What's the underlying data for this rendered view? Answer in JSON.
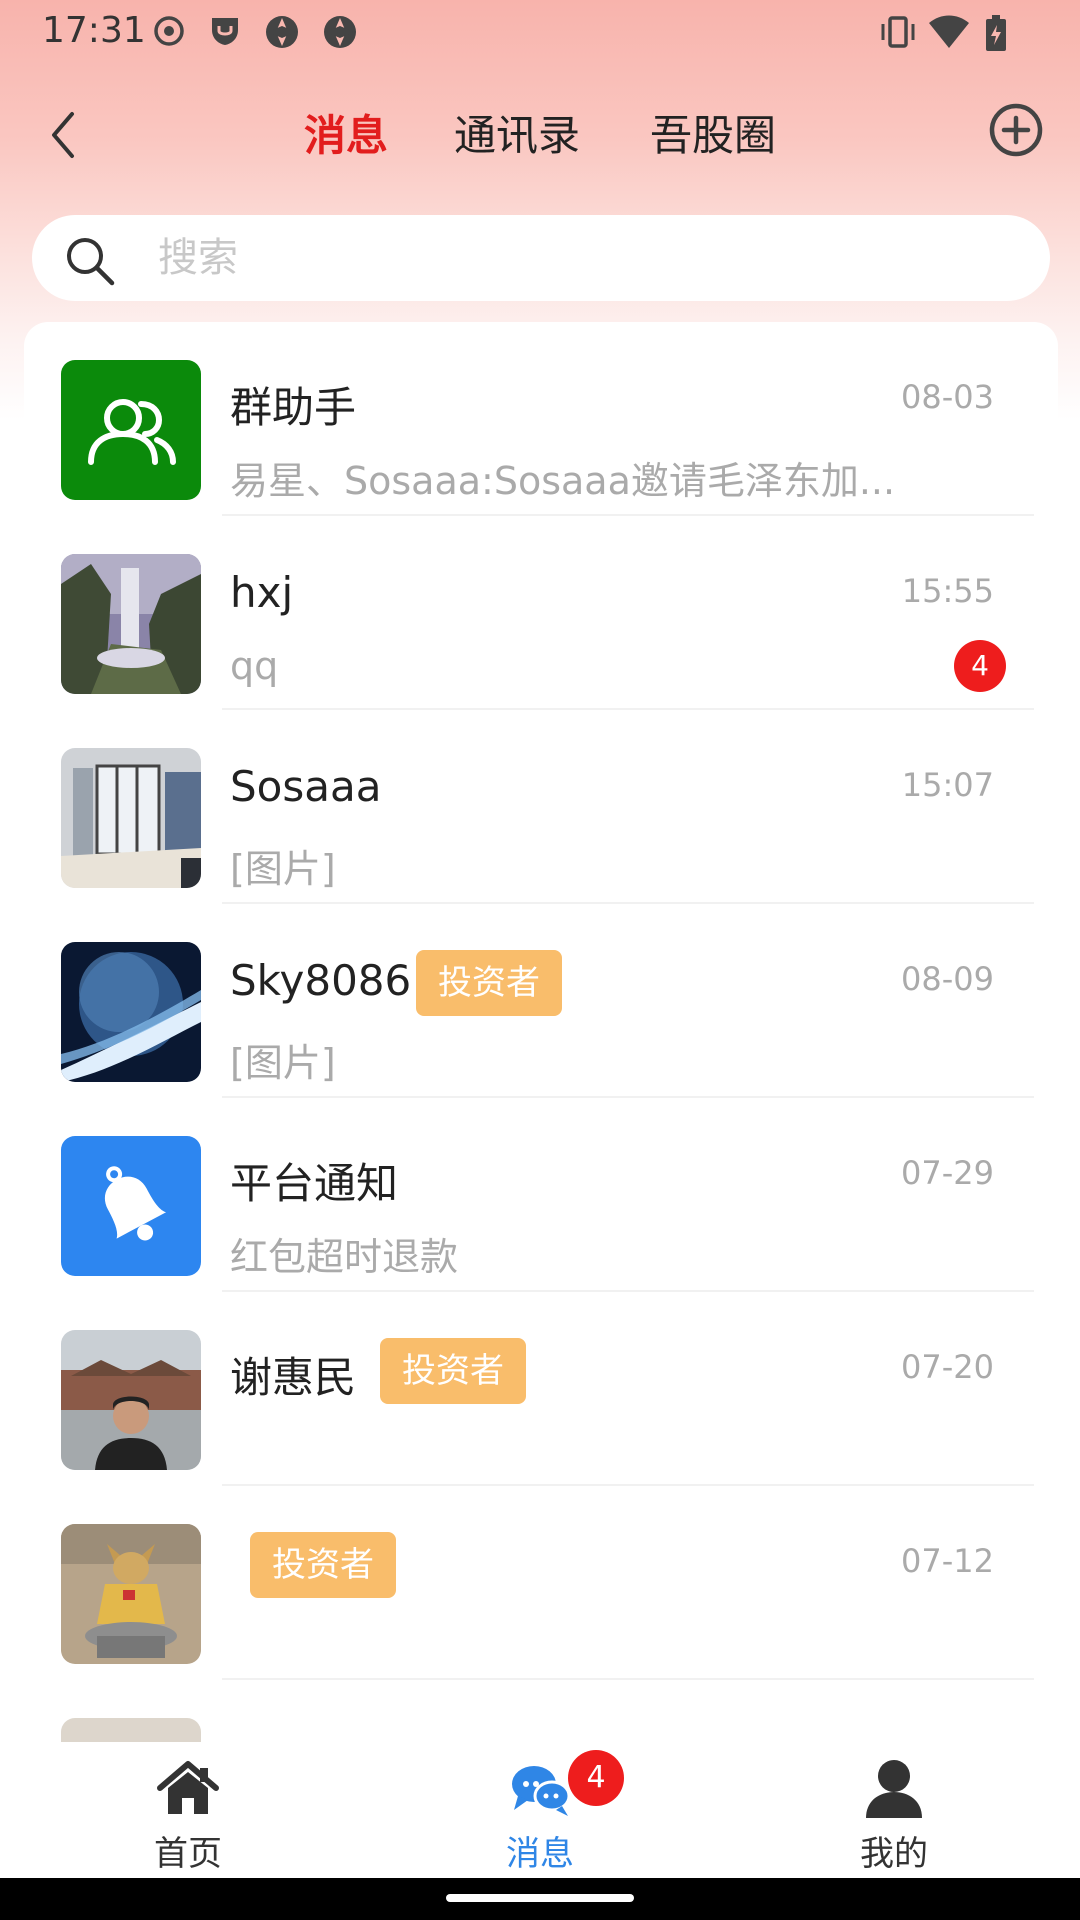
{
  "status_bar": {
    "time": "17:31",
    "left_icons": [
      "record-icon",
      "shield-icon",
      "app-icon",
      "app-icon"
    ],
    "right_icons": [
      "vibrate-icon",
      "wifi-icon",
      "battery-icon"
    ]
  },
  "header": {
    "tabs": [
      {
        "label": "消息",
        "active": true
      },
      {
        "label": "通讯录",
        "active": false
      },
      {
        "label": "吾股圈",
        "active": false
      }
    ]
  },
  "search": {
    "placeholder": "搜索",
    "value": ""
  },
  "conversations": [
    {
      "name": "群助手",
      "time": "08-03",
      "preview": "易星、Sosaaa:Sosaaa邀请毛泽东加...",
      "avatar": "group-icon",
      "tag": "",
      "unread": ""
    },
    {
      "name": "hxj",
      "time": "15:55",
      "preview": "qq",
      "avatar": "waterfall-photo",
      "tag": "",
      "unread": "4"
    },
    {
      "name": "Sosaaa",
      "time": "15:07",
      "preview": "[图片]",
      "avatar": "room-photo",
      "tag": "",
      "unread": ""
    },
    {
      "name": "Sky8086",
      "time": "08-09",
      "preview": "[图片]",
      "avatar": "planet-photo",
      "tag": "投资者",
      "unread": ""
    },
    {
      "name": "平台通知",
      "time": "07-29",
      "preview": "红包超时退款",
      "avatar": "bell-icon",
      "tag": "",
      "unread": ""
    },
    {
      "name": "谢惠民",
      "time": "07-20",
      "preview": "",
      "avatar": "person-photo",
      "tag": "投资者",
      "unread": ""
    },
    {
      "name": "",
      "time": "07-12",
      "preview": "",
      "avatar": "bull-statue-photo",
      "tag": "投资者",
      "unread": ""
    }
  ],
  "bottom_nav": [
    {
      "label": "首页",
      "icon": "home-icon",
      "active": false
    },
    {
      "label": "消息",
      "icon": "chat-icon",
      "active": true,
      "badge": "4"
    },
    {
      "label": "我的",
      "icon": "user-icon",
      "active": false
    }
  ],
  "colors": {
    "accent": "#e21d1d",
    "active_nav": "#2f86e6",
    "tag": "#f9bd6b",
    "group_avatar": "#0b8a0b",
    "notify_avatar": "#2d86f0"
  }
}
